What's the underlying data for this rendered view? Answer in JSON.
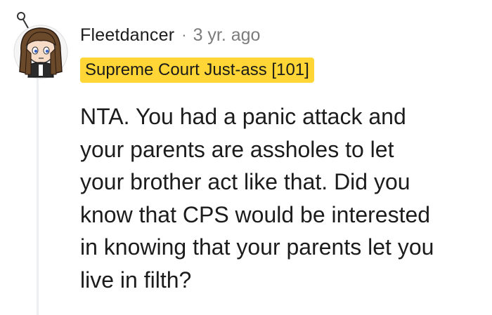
{
  "comment": {
    "author": "Fleetdancer",
    "separator": "·",
    "timestamp": "3 yr. ago",
    "flair": {
      "text": "Supreme Court Just-ass [101]",
      "color": "#ffd635"
    },
    "avatar_icon": "cartoon-avatar-icon",
    "body_lines": [
      "NTA. You had a panic attack and",
      "your parents are assholes to let",
      "your brother act like that. Did you",
      "know that CPS would be interested",
      "in knowing that your parents let you",
      "live in filth?"
    ]
  }
}
